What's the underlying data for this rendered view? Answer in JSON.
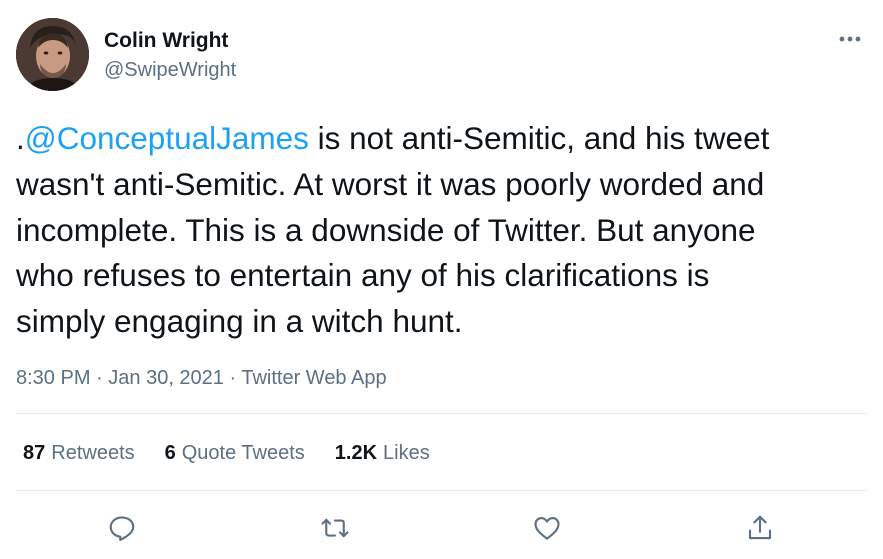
{
  "author": {
    "display_name": "Colin Wright",
    "handle": "@SwipeWright"
  },
  "tweet": {
    "prefix": ".",
    "mention": "@ConceptualJames",
    "line1_rest": " is not anti-Semitic, and his tweet",
    "line2": "wasn't anti-Semitic. At worst it was poorly worded and",
    "line3": "incomplete. This is a downside of Twitter. But anyone",
    "line4": "who refuses to entertain any of his clarifications is",
    "line5": "simply engaging in a witch hunt."
  },
  "meta": {
    "time": "8:30 PM",
    "separator1": " · ",
    "date": "Jan 30, 2021",
    "separator2": " · ",
    "source": "Twitter Web App"
  },
  "stats": {
    "retweets_count": "87",
    "retweets_label": "Retweets",
    "quotes_count": "6",
    "quotes_label": "Quote Tweets",
    "likes_count": "1.2K",
    "likes_label": "Likes"
  },
  "icons": {
    "more": "more-horizontal-icon",
    "reply": "reply-icon",
    "retweet": "retweet-icon",
    "like": "heart-icon",
    "share": "share-icon"
  },
  "colors": {
    "accent": "#1da1f2",
    "muted": "#5b7083",
    "text": "#0f1419",
    "divider": "#e6ecf0"
  }
}
